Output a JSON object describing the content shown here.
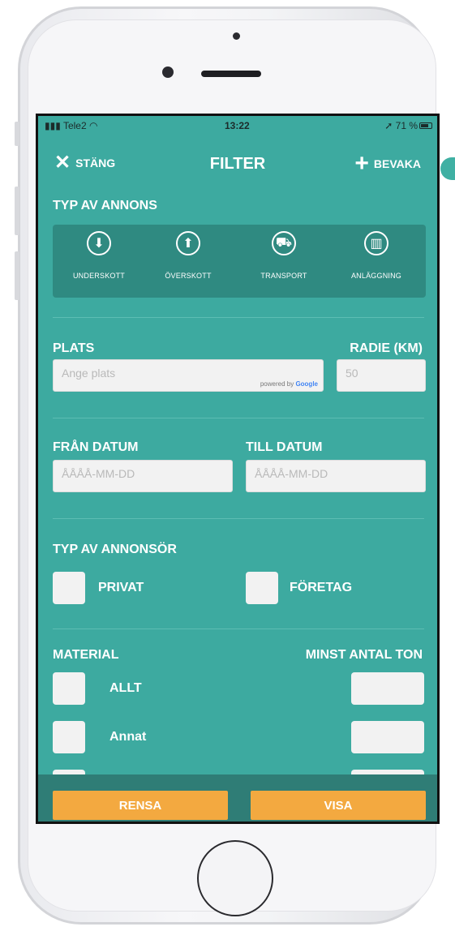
{
  "status": {
    "carrier": "Tele2",
    "time": "13:22",
    "battery": "71 %"
  },
  "nav": {
    "close_label": "STÄNG",
    "title": "FILTER",
    "watch_label": "BEVAKA"
  },
  "type_section": {
    "heading": "TYP AV ANNONS",
    "items": [
      {
        "label": "UNDERSKOTT",
        "icon": "arrow-down-icon"
      },
      {
        "label": "ÖVERSKOTT",
        "icon": "arrow-up-icon"
      },
      {
        "label": "TRANSPORT",
        "icon": "truck-icon"
      },
      {
        "label": "ANLÄGGNING",
        "icon": "facility-icon"
      }
    ]
  },
  "location": {
    "heading": "PLATS",
    "placeholder": "Ange plats",
    "powered_prefix": "powered by",
    "powered_brand": "Google",
    "radius_heading": "RADIE (KM)",
    "radius_placeholder": "50"
  },
  "dates": {
    "from_heading": "FRÅN DATUM",
    "from_placeholder": "ÅÅÅÅ-MM-DD",
    "to_heading": "TILL DATUM",
    "to_placeholder": "ÅÅÅÅ-MM-DD"
  },
  "advertiser": {
    "heading": "TYP AV ANNONSÖR",
    "options": [
      "PRIVAT",
      "FÖRETAG"
    ]
  },
  "material": {
    "heading": "MATERIAL",
    "min_ton_heading": "MINST ANTAL TON",
    "items": [
      "ALLT",
      "Annat"
    ]
  },
  "actions": {
    "clear": "RENSA",
    "show": "VISA"
  }
}
